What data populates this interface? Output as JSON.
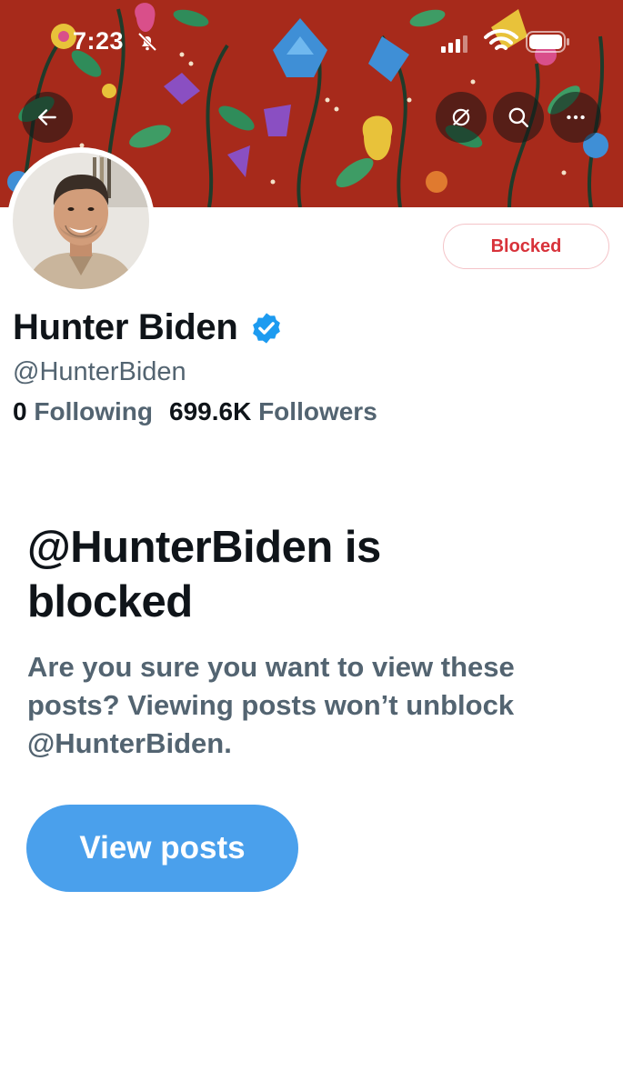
{
  "status_bar": {
    "time": "7:23",
    "icons": [
      "bell-muted-icon",
      "signal-icon",
      "wifi-icon",
      "battery-icon"
    ]
  },
  "header": {
    "nav_icons": [
      "back-arrow-icon",
      "hide-icon",
      "search-icon",
      "more-icon"
    ]
  },
  "profile": {
    "display_name": "Hunter Biden",
    "handle": "@HunterBiden",
    "verified": true,
    "following_count": "0",
    "following_label": "Following",
    "followers_count": "699.6K",
    "followers_label": "Followers",
    "blocked_button_label": "Blocked"
  },
  "blocked_notice": {
    "title": "@HunterBiden is blocked",
    "description": "Are you sure you want to view these posts? Viewing posts won’t unblock @HunterBiden.",
    "view_posts_label": "View posts"
  },
  "colors": {
    "accent": "#4aa0ec",
    "blocked_red": "#d8323a",
    "secondary_text": "#536471",
    "banner_bg": "#b2301f",
    "verified_blue": "#1d9bf0"
  }
}
